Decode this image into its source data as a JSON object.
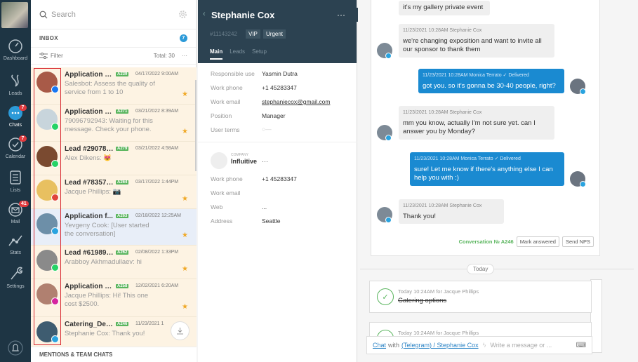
{
  "nav": {
    "items": [
      {
        "label": "Dashboard",
        "icon": "dashboard-icon"
      },
      {
        "label": "Leads",
        "icon": "leads-icon"
      },
      {
        "label": "Chats",
        "icon": "chats-icon",
        "badge": "7"
      },
      {
        "label": "Calendar",
        "icon": "calendar-icon",
        "badge": "7"
      },
      {
        "label": "Lists",
        "icon": "lists-icon"
      },
      {
        "label": "Mail",
        "icon": "mail-icon",
        "badge": "41"
      },
      {
        "label": "Stats",
        "icon": "stats-icon"
      },
      {
        "label": "Settings",
        "icon": "settings-icon"
      }
    ]
  },
  "list": {
    "search_placeholder": "Search",
    "inbox_title": "INBOX",
    "inbox_count": "7",
    "filter_label": "Filter",
    "total": "Total: 30",
    "more": "···",
    "mentions": "MENTIONS & TEAM CHATS",
    "chats": [
      {
        "name": "Application fr...",
        "tag": "A239",
        "date": "04/17/2022 9:00AM",
        "message": "Salesbot: Assess the quality of service from 1 to 10",
        "channel_color": "#1877f2",
        "star": true
      },
      {
        "name": "Application fr...",
        "tag": "A271",
        "date": "03/21/2022 8:39AM",
        "message": "79096792943: Waiting for this message. Check your phone.",
        "channel_color": "#25d366",
        "star": true
      },
      {
        "name": "Lead #2907862",
        "tag": "A279",
        "date": "03/21/2022 4:58AM",
        "message": "Alex Dikens: 😻",
        "channel_color": "#25d366",
        "star": false
      },
      {
        "name": "Lead #7835790",
        "tag": "A264",
        "date": "03/17/2022 1:44PM",
        "message": "Jacque Phillips: 📷",
        "channel_color": "#e0443a",
        "star": true
      },
      {
        "name": "Application f...",
        "tag": "A263",
        "date": "02/18/2022 12:25AM",
        "message": "Yevgeny Cook: [User started the conversation]",
        "channel_color": "#2aa3df",
        "star": true
      },
      {
        "name": "Lead #6198982",
        "tag": "A262",
        "date": "02/08/2022 1:33PM",
        "message": "Arabboy Akhmadullaev: hi",
        "channel_color": "#25d366",
        "star": true
      },
      {
        "name": "Application fr...",
        "tag": "A258",
        "date": "12/02/2021 6:20AM",
        "message": "Jacque Phillips: Hi! This one cost $2500.",
        "channel_color": "#d6249f",
        "star": true
      },
      {
        "name": "Catering_Dec...",
        "tag": "A246",
        "date": "11/23/2021 1",
        "message": "Stephanie Cox: Thank you!",
        "channel_color": "#2aa3df",
        "star": false
      }
    ]
  },
  "card": {
    "title": "Stephanie Cox",
    "more": "···",
    "id": "#11143242",
    "badges": [
      "VIP",
      "Urgent"
    ],
    "tabs": [
      "Main",
      "Leads",
      "Setup"
    ],
    "contact_fields": [
      {
        "label": "Responsible use",
        "value": "Yasmin Dutra"
      },
      {
        "label": "Work phone",
        "value": "+1 45283347"
      },
      {
        "label": "Work email",
        "value": "stephaniecox@gmail.com"
      },
      {
        "label": "Position",
        "value": "Manager"
      },
      {
        "label": "User terms",
        "value": ""
      }
    ],
    "company_caption": "COMPANY",
    "company_name": "Influitive",
    "company_more": "···",
    "company_fields": [
      {
        "label": "Work phone",
        "value": "+1 45283347"
      },
      {
        "label": "Work email",
        "value": ""
      },
      {
        "label": "Web",
        "value": "..."
      },
      {
        "label": "Address",
        "value": "Seattle"
      }
    ]
  },
  "feed": {
    "messages": [
      {
        "dir": "in",
        "meta": "",
        "text": "it's my gallery private event"
      },
      {
        "dir": "in",
        "meta": "11/23/2021 10:28AM Stephanie Cox",
        "text": "we're changing exposition and want to invite all our sponsor to thank them"
      },
      {
        "dir": "out",
        "meta": "11/23/2021 10:28AM Monica Terrato ✓ Delivered",
        "text": "got you. so it's gonna be 30-40 people, right?"
      },
      {
        "dir": "in",
        "meta": "11/23/2021 10:28AM Stephanie Cox",
        "text": "mm you know, actually I'm not sure yet. can I answer you by Monday?"
      },
      {
        "dir": "out",
        "meta": "11/23/2021 10:28AM Monica Terrato ✓ Delivered",
        "text": "sure! Let me know if there's anything else I can help you with :)"
      },
      {
        "dir": "in",
        "meta": "11/23/2021 10:28AM Stephanie Cox",
        "text": "Thank you!"
      }
    ],
    "conversation_no": "Conversation № A246",
    "mark_answered": "Mark answered",
    "send_nps": "Send NPS",
    "today": "Today",
    "tasks": [
      {
        "meta": "Today 10:24AM for Jacque Phillips",
        "text": "Catering options"
      },
      {
        "meta": "Today 10:24AM for Jacque Phillips",
        "text": ""
      }
    ],
    "compose_chat": "Chat",
    "compose_with": "with",
    "compose_target": "(Telegram) / Stephanie Cox",
    "compose_placeholder": "Write a message or ..."
  }
}
